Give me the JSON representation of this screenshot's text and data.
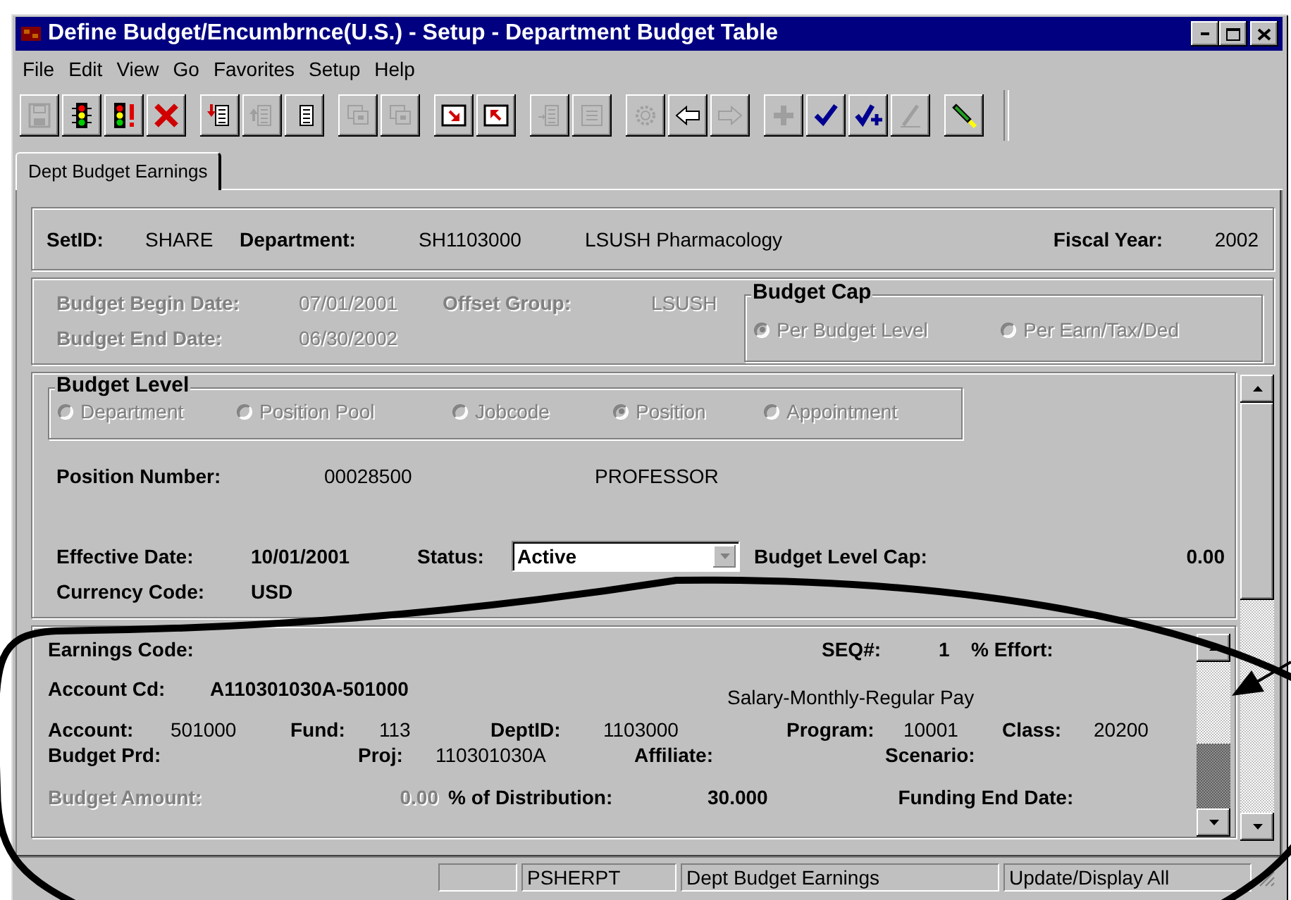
{
  "window": {
    "title": "Define Budget/Encumbrnce(U.S.) - Setup - Department Budget Table"
  },
  "menu": [
    {
      "label": "File"
    },
    {
      "label": "Edit"
    },
    {
      "label": "View"
    },
    {
      "label": "Go"
    },
    {
      "label": "Favorites"
    },
    {
      "label": "Setup"
    },
    {
      "label": "Help"
    }
  ],
  "toolbar": [
    [
      {
        "kind": "save",
        "disabled": true
      },
      {
        "kind": "light",
        "disabled": false
      },
      {
        "kind": "light-alert",
        "disabled": false
      },
      {
        "kind": "cross",
        "disabled": false
      }
    ],
    [
      {
        "kind": "doc-down",
        "disabled": false
      },
      {
        "kind": "doc-up",
        "disabled": true
      },
      {
        "kind": "doc",
        "disabled": false
      }
    ],
    [
      {
        "kind": "windows",
        "disabled": true
      },
      {
        "kind": "windows",
        "disabled": true
      }
    ],
    [
      {
        "kind": "next-page",
        "disabled": false
      },
      {
        "kind": "prev-page",
        "disabled": false
      }
    ],
    [
      {
        "kind": "list-in",
        "disabled": true
      },
      {
        "kind": "list-out",
        "disabled": true
      }
    ],
    [
      {
        "kind": "gear",
        "disabled": true
      },
      {
        "kind": "arrow-left",
        "disabled": false
      },
      {
        "kind": "arrow-right",
        "disabled": true
      }
    ],
    [
      {
        "kind": "plus",
        "disabled": true
      },
      {
        "kind": "check",
        "disabled": false
      },
      {
        "kind": "check-plus",
        "disabled": false
      },
      {
        "kind": "pencil",
        "disabled": true
      }
    ],
    [
      {
        "kind": "wand",
        "disabled": false
      }
    ]
  ],
  "tabs": [
    {
      "label": "Dept Budget Earnings",
      "selected": true
    }
  ],
  "header": {
    "cells": [
      {
        "kind": "label",
        "text": "SetID:"
      },
      {
        "kind": "value",
        "text": "SHARE"
      },
      {
        "kind": "label",
        "text": "Department:"
      },
      {
        "kind": "value",
        "text": "SH1103000"
      },
      {
        "kind": "value",
        "text": "LSUSH Pharmacology"
      },
      {
        "kind": "label",
        "text": "Fiscal Year:"
      },
      {
        "kind": "value",
        "text": "2002"
      }
    ]
  },
  "dates": {
    "disabled": true,
    "rows": [
      [
        {
          "kind": "label",
          "text": "Budget Begin Date:"
        },
        {
          "kind": "value",
          "text": "07/01/2001"
        },
        {
          "kind": "label",
          "text": "Offset Group:"
        },
        {
          "kind": "value",
          "text": "LSUSH"
        }
      ],
      [
        {
          "kind": "label",
          "text": "Budget End Date:"
        },
        {
          "kind": "value",
          "text": "06/30/2002"
        }
      ]
    ],
    "budget_cap": {
      "title": "Budget Cap",
      "disabled": true,
      "options": [
        {
          "label": "Per Budget Level",
          "selected": true
        },
        {
          "label": "Per Earn/Tax/Ded",
          "selected": false
        }
      ]
    }
  },
  "budget_level": {
    "title": "Budget Level",
    "disabled": true,
    "options": [
      {
        "label": "Department",
        "selected": false
      },
      {
        "label": "Position Pool",
        "selected": false
      },
      {
        "label": "Jobcode",
        "selected": false
      },
      {
        "label": "Position",
        "selected": true
      },
      {
        "label": "Appointment",
        "selected": false
      }
    ],
    "rows": [
      [
        {
          "kind": "label",
          "text": "Position Number:"
        },
        {
          "kind": "value",
          "text": "00028500"
        },
        {
          "kind": "value",
          "text": "PROFESSOR"
        }
      ],
      [
        {
          "kind": "label",
          "text": "Effective Date:"
        },
        {
          "kind": "strong",
          "text": "10/01/2001"
        },
        {
          "kind": "label",
          "text": "Status:"
        },
        {
          "kind": "dropdown",
          "text": "Active"
        },
        {
          "kind": "label",
          "text": "Budget Level Cap:"
        },
        {
          "kind": "strong",
          "text": "0.00"
        }
      ],
      [
        {
          "kind": "label",
          "text": "Currency Code:"
        },
        {
          "kind": "strong",
          "text": "USD"
        }
      ]
    ]
  },
  "earnings": {
    "lines": [
      [
        {
          "kind": "label",
          "text": "Earnings Code:",
          "disabled": false
        },
        {
          "kind": "label",
          "text": "SEQ#:",
          "disabled": false
        },
        {
          "kind": "strong",
          "text": "1",
          "disabled": false
        },
        {
          "kind": "label",
          "text": "% Effort:",
          "disabled": false
        }
      ],
      [
        {
          "kind": "label",
          "text": "Account Cd:",
          "disabled": false
        },
        {
          "kind": "strong",
          "text": "A110301030A-501000",
          "disabled": false
        },
        {
          "kind": "value",
          "text": "Salary-Monthly-Regular Pay",
          "disabled": false
        }
      ],
      [
        {
          "kind": "label",
          "text": "Account:",
          "disabled": false
        },
        {
          "kind": "value",
          "text": "501000",
          "disabled": false
        },
        {
          "kind": "label",
          "text": "Fund:",
          "disabled": false
        },
        {
          "kind": "value",
          "text": "113",
          "disabled": false
        },
        {
          "kind": "label",
          "text": "DeptID:",
          "disabled": false
        },
        {
          "kind": "value",
          "text": "1103000",
          "disabled": false
        },
        {
          "kind": "label",
          "text": "Program:",
          "disabled": false
        },
        {
          "kind": "value",
          "text": "10001",
          "disabled": false
        },
        {
          "kind": "label",
          "text": "Class:",
          "disabled": false
        },
        {
          "kind": "value",
          "text": "20200",
          "disabled": false
        }
      ],
      [
        {
          "kind": "label",
          "text": "Budget Prd:",
          "disabled": false
        },
        {
          "kind": "label",
          "text": "Proj:",
          "disabled": false
        },
        {
          "kind": "value",
          "text": "110301030A",
          "disabled": false
        },
        {
          "kind": "label",
          "text": "Affiliate:",
          "disabled": false
        },
        {
          "kind": "label",
          "text": "Scenario:",
          "disabled": false
        }
      ],
      [
        {
          "kind": "label",
          "text": "Budget Amount:",
          "disabled": true
        },
        {
          "kind": "strong",
          "text": "0.00",
          "disabled": true
        },
        {
          "kind": "label",
          "text": "% of Distribution:",
          "disabled": false
        },
        {
          "kind": "strong",
          "text": "30.000",
          "disabled": false
        },
        {
          "kind": "label",
          "text": "Funding End Date:",
          "disabled": false
        }
      ]
    ]
  },
  "status_bar": {
    "panes": [
      "PSHERPT",
      "Dept Budget Earnings",
      "Update/Display All"
    ]
  }
}
